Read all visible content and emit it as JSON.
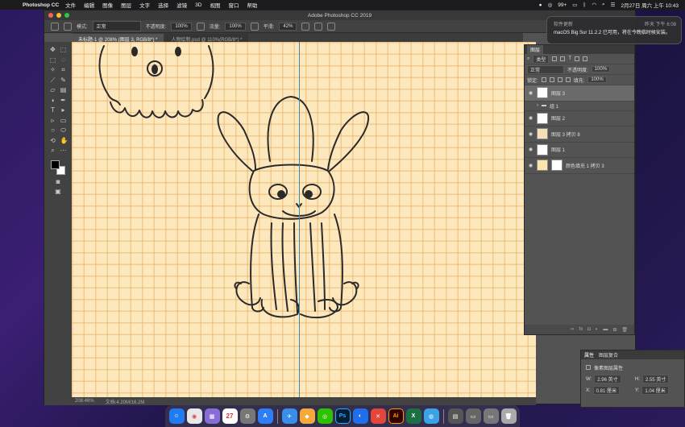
{
  "menubar": {
    "app_name": "Photoshop CC",
    "menus": [
      "文件",
      "编辑",
      "图像",
      "图层",
      "文字",
      "选择",
      "滤镜",
      "3D",
      "视图",
      "窗口",
      "帮助"
    ],
    "battery": "99+",
    "clock": "2月27日 周六 上午 10:43"
  },
  "window": {
    "title": "Adobe Photoshop CC 2019",
    "traffic": {
      "close": "#fe5f57",
      "minimize": "#febc2e",
      "zoom": "#28c840"
    }
  },
  "options_bar": {
    "mode_label": "模式:",
    "mode_value": "正常",
    "opacity_label": "不透明度:",
    "opacity_value": "100%",
    "flow_label": "流量:",
    "flow_value": "100%",
    "smooth_label": "平滑:",
    "smooth_value": "42%"
  },
  "doc_tabs": [
    {
      "label": "未标题-1 @ 208% (图层 3, RGB/8*) *",
      "active": true
    },
    {
      "label": "人物绘制.psd @ 110%(RGB/8*) *",
      "active": false
    }
  ],
  "status": {
    "zoom": "208.46%",
    "doc_size": "文档:4.20M/16.2M"
  },
  "layers_panel": {
    "tab": "图层",
    "filter_value": "类型",
    "blend_mode": "正常",
    "opacity_label": "不透明度:",
    "opacity_value": "100%",
    "lock_label": "锁定:",
    "fill_label": "填充:",
    "fill_value": "100%",
    "layers": [
      {
        "name": "图层 3",
        "selected": true,
        "thumb": "white"
      },
      {
        "name": "组 1",
        "group": true
      },
      {
        "name": "图层 2",
        "thumb": "white"
      },
      {
        "name": "图层 3 拷贝 8",
        "thumb": "orange"
      },
      {
        "name": "图层 1",
        "thumb": "white"
      },
      {
        "name": "颜色填充 1 拷贝 3",
        "thumb": "yellow"
      }
    ]
  },
  "notification": {
    "app": "软件更新",
    "time": "昨天 下午 6:08",
    "message": "macOS Big Sur 11.2.2 已可用，将在今晚临时候安装。"
  },
  "properties_panel": {
    "tab1": "属性",
    "tab2": "图层复合",
    "title": "像素图层属性",
    "w_label": "W:",
    "w_value": "2.96 英寸",
    "h_label": "H:",
    "h_value": "2.55 英寸",
    "x_label": "X:",
    "x_value": "0.81 厘米",
    "y_label": "Y:",
    "y_value": "1.04 厘米"
  },
  "dock": {
    "calendar_day": "27",
    "photoshop_label": "Ps",
    "illustrator_label": "Ai"
  },
  "colors": {
    "paper": "#fde8bd",
    "grid": "#e7b066",
    "guide": "#3d8aa8",
    "stroke": "#2a2a2a"
  }
}
